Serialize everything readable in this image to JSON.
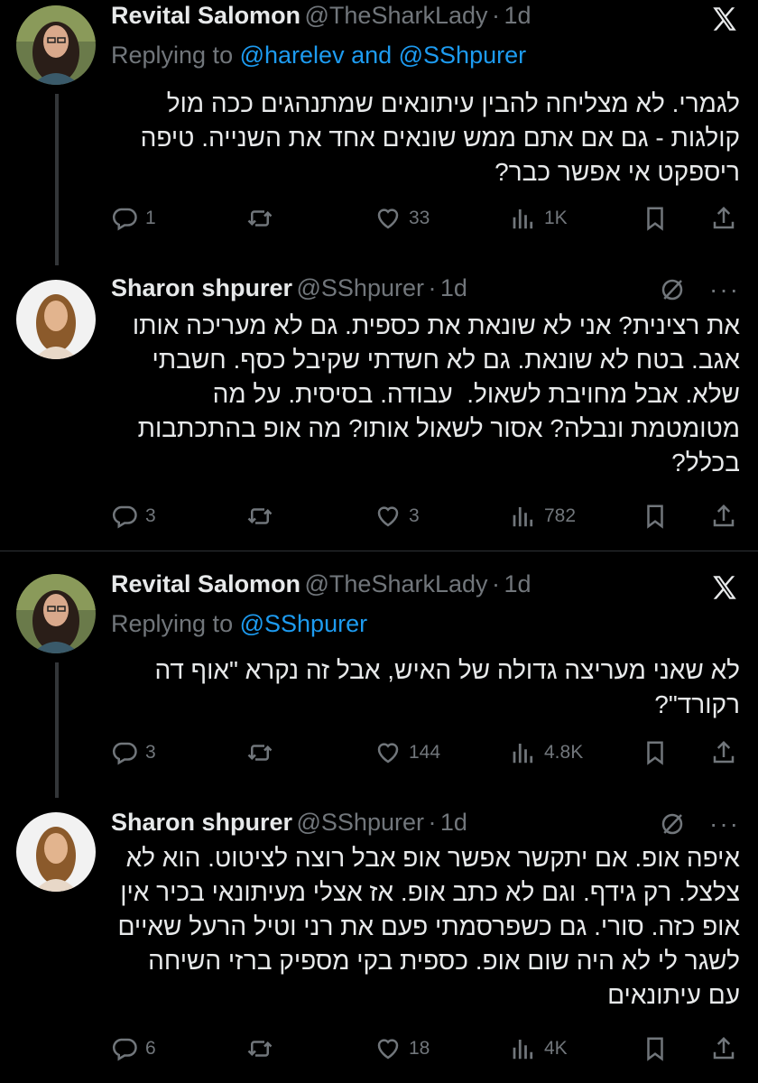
{
  "tweets": [
    {
      "name": "Revital Salomon",
      "handle": "@TheSharkLady",
      "dot": "·",
      "time": "1d",
      "replying_prefix": "Replying to",
      "replying_to": "@harelev and @SShpurer",
      "text": "לגמרי. לא מצליחה להבין עיתונאים שמתנהגים ככה מול\nקולגות - גם אם אתם ממש שונאים אחד את השנייה. טיפה\nריספקט אי אפשר כבר?",
      "replies": "1",
      "reposts": "",
      "likes": "33",
      "views": "1K"
    },
    {
      "name": "Sharon shpurer",
      "handle": "@SShpurer",
      "dot": "·",
      "time": "1d",
      "text": "את רצינית? אני לא שונאת את כספית. גם לא מעריכה אותו\nאגב. בטח לא שונאת. גם לא חשדתי שקיבל כסף. חשבתי\nשלא. אבל מחויבת לשאול.  עבודה. בסיסית. על מה\nמטומטמת ונבלה? אסור לשאול אותו? מה אופ בהתכתבות\nבכלל?",
      "replies": "3",
      "reposts": "",
      "likes": "3",
      "views": "782"
    },
    {
      "name": "Revital Salomon",
      "handle": "@TheSharkLady",
      "dot": "·",
      "time": "1d",
      "replying_prefix": "Replying to",
      "replying_to": "@SShpurer",
      "text": "לא שאני מעריצה גדולה של האיש, אבל זה נקרא \"אוף דה\nרקורד\"?",
      "replies": "3",
      "reposts": "",
      "likes": "144",
      "views": "4.8K"
    },
    {
      "name": "Sharon shpurer",
      "handle": "@SShpurer",
      "dot": "·",
      "time": "1d",
      "text": "איפה אופ. אם יתקשר אפשר אופ אבל רוצה לציטוט. הוא לא\nצלצל. רק גידף. וגם לא כתב אופ. אז אצלי מעיתונאי בכיר אין\nאופ כזה. סורי. גם כשפרסמתי פעם את רני וטיל הרעל שאיים\nלשגר לי לא היה שום אופ. כספית בקי מספיק ברזי השיחה\nעם עיתונאים",
      "replies": "6",
      "reposts": "",
      "likes": "18",
      "views": "4K"
    }
  ],
  "icons": {
    "reply": "reply-icon",
    "repost": "repost-icon",
    "like": "heart-icon",
    "views": "views-icon",
    "bookmark": "bookmark-icon",
    "share": "share-icon",
    "x": "x-logo-icon",
    "mute": "mute-icon",
    "more": "more-icon"
  },
  "colors": {
    "background": "#000000",
    "text": "#e7e9ea",
    "muted": "#71767b",
    "link": "#1d9bf0"
  }
}
